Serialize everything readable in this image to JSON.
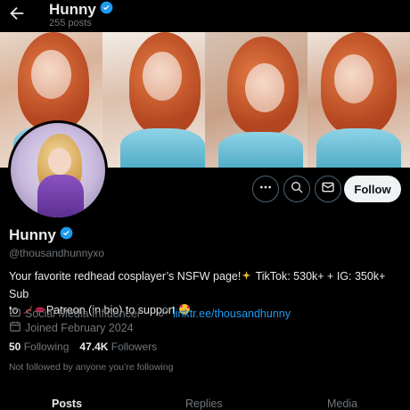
{
  "header": {
    "name": "Hunny",
    "posts_count": "255 posts",
    "back_icon": "arrow-left-icon",
    "verified_icon": "verified-badge-icon"
  },
  "banner": {
    "panels": 4,
    "description_icon": "banner-image"
  },
  "actions": {
    "more_icon": "more-horizontal-icon",
    "search_icon": "search-icon",
    "message_icon": "mail-icon",
    "follow_label": "Follow"
  },
  "profile": {
    "display_name": "Hunny",
    "handle": "@thousandhunnyxo",
    "bio_line1_a": "Your favorite redhead cosplayer’s NSFW page!",
    "bio_line1_b": " TikTok: 530k+ + IG: 350k+ Sub",
    "bio_line2_a": "to ",
    "bio_line2_b": "Patreon (in bio) to support ",
    "category": "Social Media Influencer",
    "link": "linktr.ee/thousandhunny",
    "joined": "Joined February 2024",
    "following_count": "50",
    "following_label": "Following",
    "followers_count": "47.4K",
    "followers_label": "Followers",
    "not_followed": "Not followed by anyone you’re following"
  },
  "tabs": [
    {
      "label": "Posts",
      "active": true
    },
    {
      "label": "Replies",
      "active": false
    },
    {
      "label": "Media",
      "active": false
    }
  ],
  "colors": {
    "background": "#000000",
    "link": "#1d9bf0",
    "muted": "#71767b",
    "verified": "#1d9bf0"
  }
}
